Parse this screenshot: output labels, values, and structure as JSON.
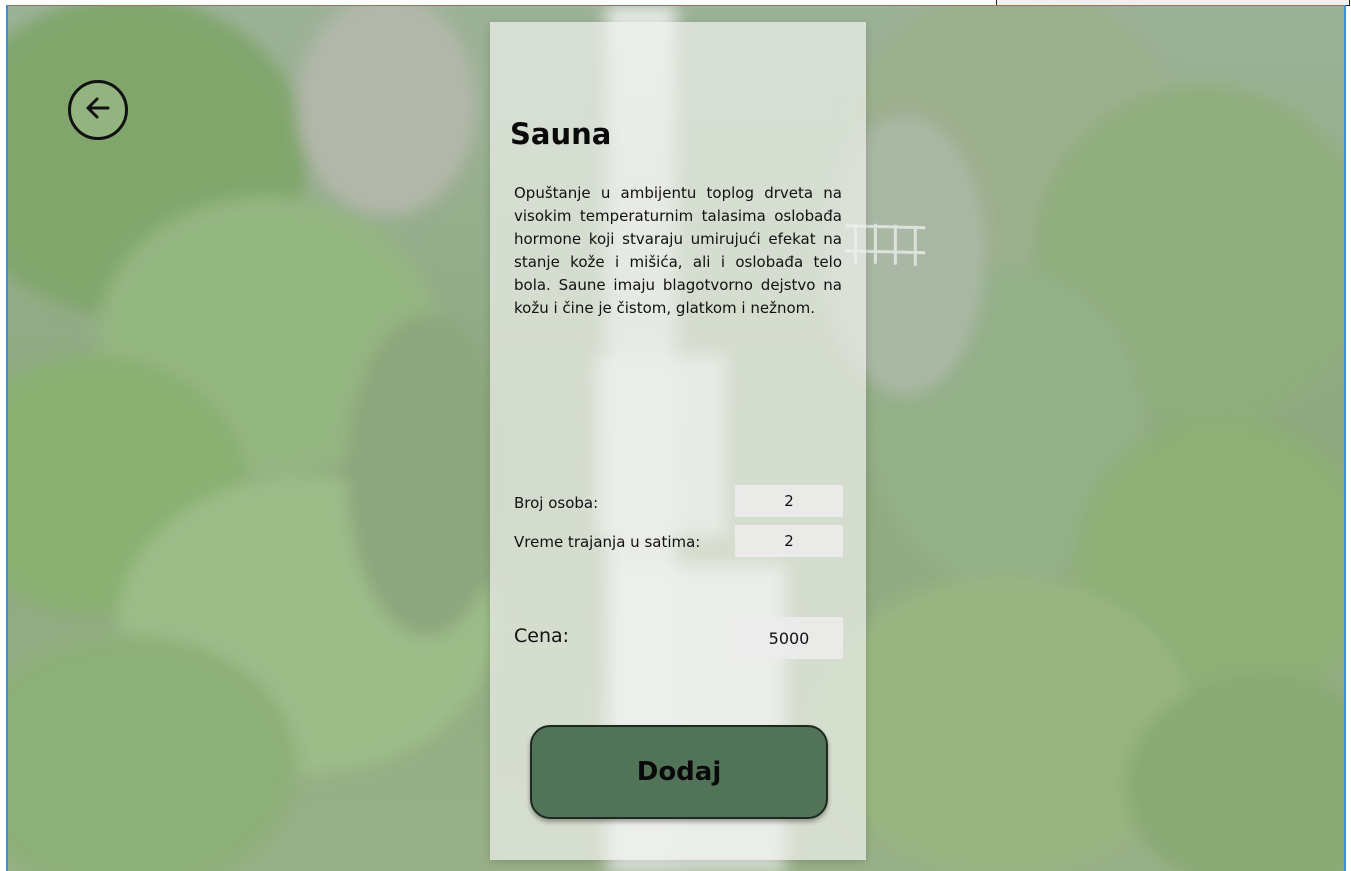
{
  "page": {
    "title": "Sauna",
    "description": "Opuštanje u ambijentu toplog drveta na visokim temperaturnim talasima oslobađa hormone koji stvaraju umirujući efekat na stanje kože i mišića, ali i oslobađa telo bola. Saune imaju blagotvorno dejstvo na kožu i čine je čistom, glatkom i nežnom."
  },
  "form": {
    "persons_label": "Broj osoba:",
    "persons_value": "2",
    "duration_label": "Vreme trajanja u satima:",
    "duration_value": "2",
    "price_label": "Cena:",
    "price_value": "5000"
  },
  "actions": {
    "add_label": "Dodaj",
    "back_icon": "arrow-left-icon"
  },
  "colors": {
    "accent_button": "#517358",
    "frame_border": "#3b8fd8",
    "panel_bg": "#eef0ec"
  }
}
